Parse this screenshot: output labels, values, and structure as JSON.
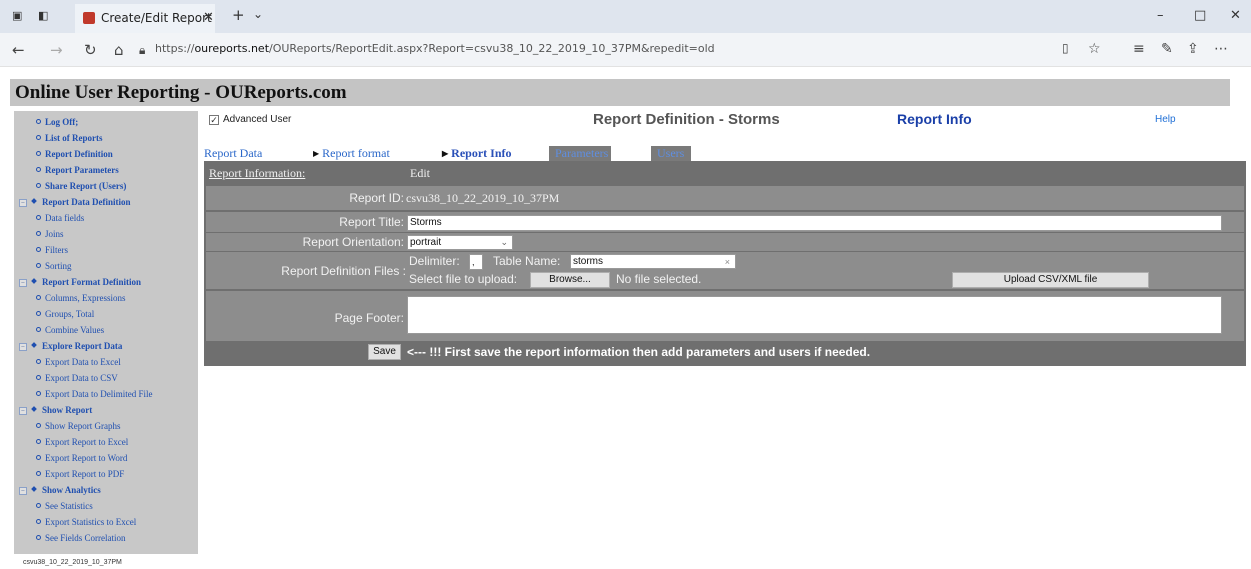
{
  "browser": {
    "tab_title": "Create/Edit Report",
    "url_prefix": "https://",
    "url_domain": "oureports.net",
    "url_path": "/OUReports/ReportEdit.aspx?Report=csvu38_10_22_2019_10_37PM&repedit=old"
  },
  "page": {
    "app_title": "Online User Reporting - OUReports.com",
    "advanced_user_label": "Advanced User",
    "report_definition_title": "Report Definition - Storms",
    "section_title": "Report Info",
    "help_label": "Help",
    "footer_report_id": "csvu38_10_22_2019_10_37PM"
  },
  "sidebar": {
    "items": [
      {
        "label": "Log Off;"
      },
      {
        "label": "List of Reports"
      },
      {
        "label": "Report Definition"
      },
      {
        "label": "Report Parameters"
      },
      {
        "label": "Share Report (Users)"
      },
      {
        "label": "Report Data Definition"
      },
      {
        "label": "Data fields"
      },
      {
        "label": "Joins"
      },
      {
        "label": "Filters"
      },
      {
        "label": "Sorting"
      },
      {
        "label": "Report Format Definition"
      },
      {
        "label": "Columns, Expressions"
      },
      {
        "label": "Groups, Total"
      },
      {
        "label": "Combine Values"
      },
      {
        "label": "Explore Report Data"
      },
      {
        "label": "Export Data to Excel"
      },
      {
        "label": "Export Data to CSV"
      },
      {
        "label": "Export Data to Delimited File"
      },
      {
        "label": "Show Report"
      },
      {
        "label": "Show Report Graphs"
      },
      {
        "label": "Export Report to Excel"
      },
      {
        "label": "Export Report to Word"
      },
      {
        "label": "Export Report to PDF"
      },
      {
        "label": "Show Analytics"
      },
      {
        "label": "See Statistics"
      },
      {
        "label": "Export Statistics to Excel"
      },
      {
        "label": "See Fields Correlation"
      }
    ]
  },
  "tabs": [
    "Report Data",
    "Report format",
    "Report Info",
    "Parameters",
    "Users"
  ],
  "form": {
    "header_label": "Report Information:",
    "edit_label": "Edit",
    "report_id_label": "Report ID:",
    "report_id_value": "csvu38_10_22_2019_10_37PM",
    "report_title_label": "Report Title:",
    "report_title_value": "Storms",
    "orientation_label": "Report Orientation:",
    "orientation_value": "portrait",
    "def_files_label": "Report Definition Files :",
    "delimiter_label": "Delimiter:",
    "delimiter_value": ",",
    "table_name_label": "Table Name:",
    "table_name_value": "storms",
    "select_file_label": "Select file to upload:",
    "browse_label": "Browse...",
    "no_file_label": "No file selected.",
    "upload_label": "Upload CSV/XML file",
    "page_footer_label": "Page Footer:",
    "page_footer_value": "",
    "save_label": "Save",
    "save_note": "<--- !!!  First save the report information then add parameters and users if needed."
  }
}
